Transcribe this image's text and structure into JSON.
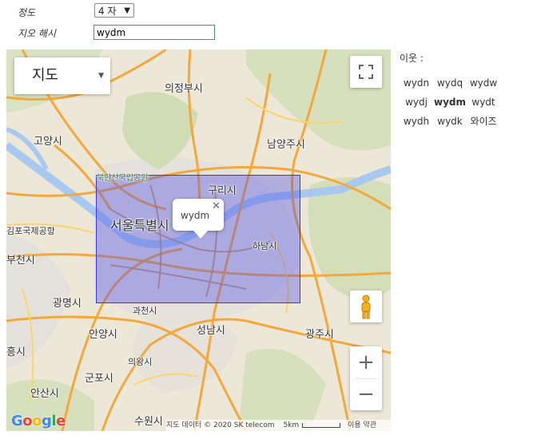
{
  "form": {
    "precision_label": "정도",
    "precision_value": "4 자",
    "hash_label": "지오 해시",
    "hash_value": "wydm"
  },
  "map": {
    "type_label": "지도",
    "info_window_text": "wydm",
    "cities": {
      "uijeongbu": "의정부시",
      "goyang": "고양시",
      "namyangju": "남양주시",
      "bukhansan": "북한산국립공원",
      "guri": "구리시",
      "seoul": "서울특별시",
      "gimpo_airport": "김포국제공항",
      "hanam": "하남시",
      "bucheon": "부천시",
      "gwangmyeong": "광명시",
      "gwacheon": "과천시",
      "anyang": "안양시",
      "seongnam": "성남시",
      "gwangju": "광주시",
      "siheung": "흥시",
      "uiwang": "의왕시",
      "gunpo": "군포시",
      "ansan": "안산시",
      "suwon": "수원시"
    },
    "google_logo": "Google",
    "attribution": "지도 데이터 © 2020 SK telecom",
    "scale_label": "5km",
    "terms": "이용 약관"
  },
  "neighbors": {
    "title": "이웃 :",
    "rows": [
      [
        "wydn",
        "wydq",
        "wydw"
      ],
      [
        "wydj",
        "wydm",
        "wydt"
      ],
      [
        "wydh",
        "wydk",
        "와이즈"
      ]
    ]
  }
}
